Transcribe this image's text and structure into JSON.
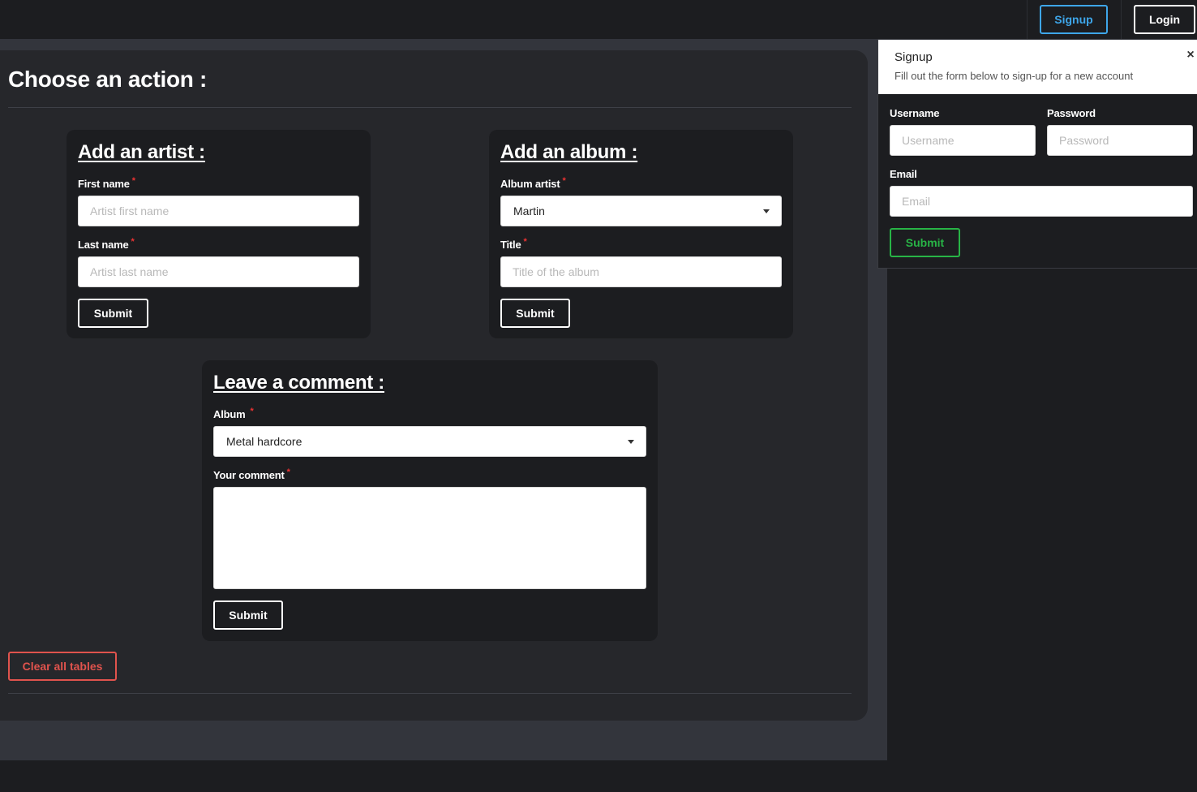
{
  "navbar": {
    "signup_label": "Signup",
    "login_label": "Login"
  },
  "main": {
    "title": "Choose an action :",
    "clear_label": "Clear all tables"
  },
  "artist_form": {
    "title": "Add an artist :",
    "first_name_label": "First name",
    "first_name_placeholder": "Artist first name",
    "last_name_label": "Last name",
    "last_name_placeholder": "Artist last name",
    "submit_label": "Submit"
  },
  "album_form": {
    "title": "Add an album :",
    "artist_label": "Album artist",
    "artist_value": "Martin",
    "title_label": "Title",
    "title_placeholder": "Title of the album",
    "submit_label": "Submit"
  },
  "comment_form": {
    "title": "Leave a comment :",
    "album_label": "Album",
    "album_value": "Metal hardcore",
    "comment_label": "Your comment",
    "submit_label": "Submit"
  },
  "required_mark": "*",
  "signup": {
    "title": "Signup",
    "subtitle": "Fill out the form below to sign-up for a new account",
    "close_glyph": "×",
    "username_label": "Username",
    "username_placeholder": "Username",
    "password_label": "Password",
    "password_placeholder": "Password",
    "email_label": "Email",
    "email_placeholder": "Email",
    "submit_label": "Submit"
  },
  "colors": {
    "background": "#1c1d20",
    "page": "#33353c",
    "panel": "#26272b",
    "accent_blue": "#3ea6e9",
    "danger": "#e0534d",
    "success": "#28b446",
    "required": "#e33333"
  }
}
